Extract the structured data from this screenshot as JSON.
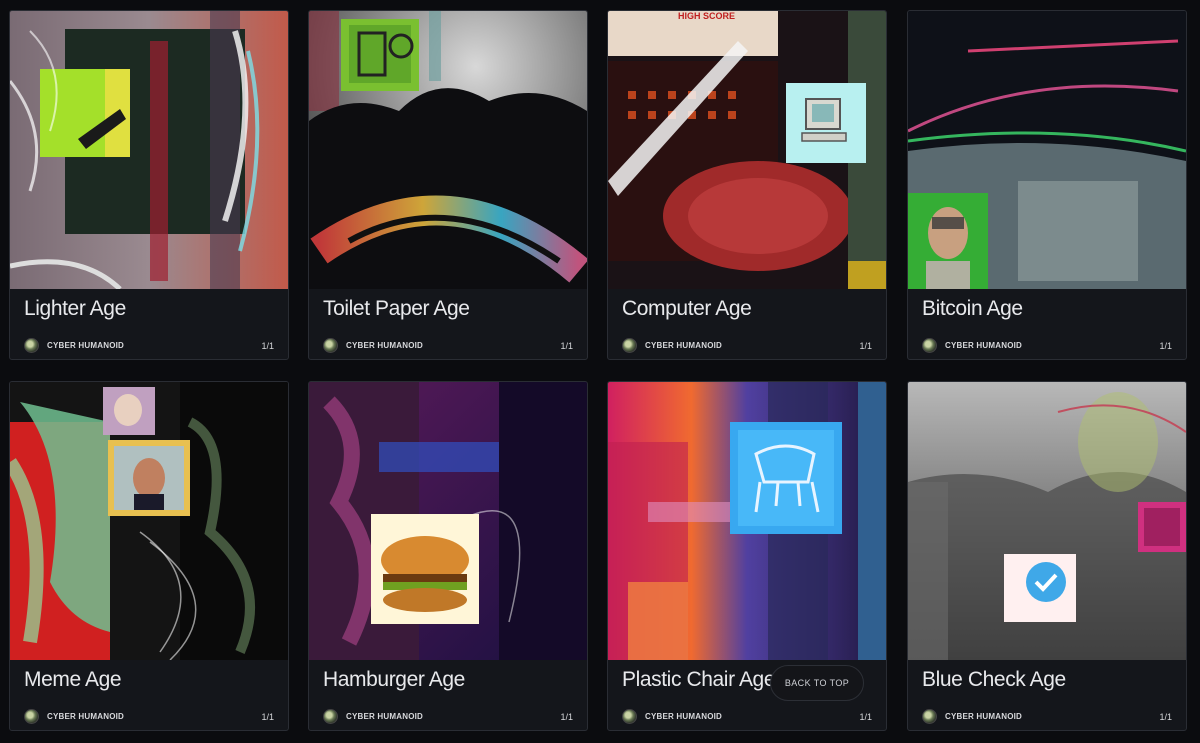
{
  "cards": [
    {
      "title": "Lighter Age",
      "creator": "CYBER HUMANOID",
      "edition": "1/1",
      "icon": "lighter-icon"
    },
    {
      "title": "Toilet Paper Age",
      "creator": "CYBER HUMANOID",
      "edition": "1/1",
      "icon": "toilet-paper-icon"
    },
    {
      "title": "Computer Age",
      "creator": "CYBER HUMANOID",
      "edition": "1/1",
      "icon": "computer-icon"
    },
    {
      "title": "Bitcoin Age",
      "creator": "CYBER HUMANOID",
      "edition": "1/1",
      "icon": "portrait-icon"
    },
    {
      "title": "Meme Age",
      "creator": "CYBER HUMANOID",
      "edition": "1/1",
      "icon": "meme-portrait-icon"
    },
    {
      "title": "Hamburger Age",
      "creator": "CYBER HUMANOID",
      "edition": "1/1",
      "icon": "hamburger-icon"
    },
    {
      "title": "Plastic Chair Age",
      "creator": "CYBER HUMANOID",
      "edition": "1/1",
      "icon": "plastic-chair-icon"
    },
    {
      "title": "Blue Check Age",
      "creator": "CYBER HUMANOID",
      "edition": "1/1",
      "icon": "blue-check-icon"
    }
  ],
  "back_to_top": "BACK TO TOP",
  "computer_art_text": "HIGH SCORE"
}
